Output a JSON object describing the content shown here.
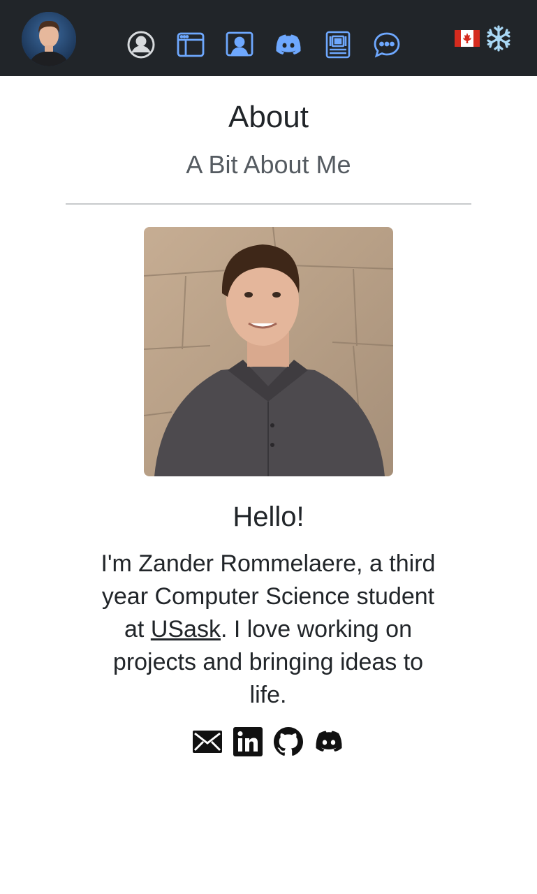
{
  "nav": {
    "items": [
      {
        "name": "nav-about",
        "icon": "person-circle-icon"
      },
      {
        "name": "nav-projects",
        "icon": "browser-window-icon"
      },
      {
        "name": "nav-portfolio",
        "icon": "person-badge-icon"
      },
      {
        "name": "nav-discord",
        "icon": "discord-icon"
      },
      {
        "name": "nav-hardware",
        "icon": "circuit-board-icon"
      },
      {
        "name": "nav-contact",
        "icon": "chat-dots-icon"
      }
    ],
    "accent_color": "#6ea8fe",
    "flag_icon": "canada-flag-icon",
    "theme_icon": "snowflake-icon"
  },
  "header": {
    "title": "About",
    "subtitle": "A Bit About Me"
  },
  "profile": {
    "greeting": "Hello!",
    "bio_part1": "I'm Zander Rommelaere, a third year Computer Science student at ",
    "bio_link": "USask",
    "bio_part2": ". I love working on projects and bringing ideas to life."
  },
  "social": [
    {
      "name": "email",
      "icon": "envelope-icon"
    },
    {
      "name": "linkedin",
      "icon": "linkedin-icon"
    },
    {
      "name": "github",
      "icon": "github-icon"
    },
    {
      "name": "discord",
      "icon": "discord-icon"
    }
  ]
}
